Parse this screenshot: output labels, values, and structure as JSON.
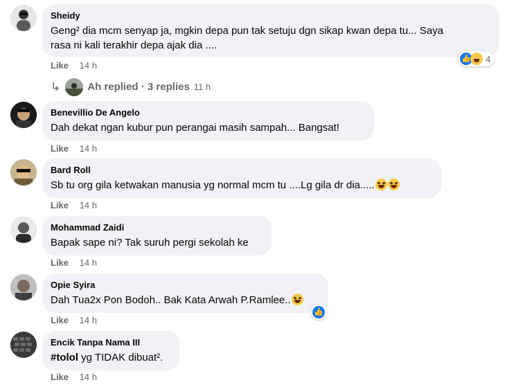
{
  "comments": [
    {
      "name": "Sheidy",
      "text_line1": "Geng² dia mcm senyap ja, mgkin depa pun tak setuju dgn sikap kwan depa tu... Saya",
      "text_line2": "rasa ni kali terakhir depa ajak dia ....",
      "like": "Like",
      "time": "14 h",
      "reaction_count": "4"
    },
    {
      "name": "Benevillio De Angelo",
      "text": "Dah dekat ngan kubur pun perangai masih sampah... Bangsat!",
      "like": "Like",
      "time": "14 h"
    },
    {
      "name": "Bard Roll",
      "text": "Sb tu org gila ketwakan manusia yg normal mcm tu ....Lg gila dr dia.....",
      "like": "Like",
      "time": "14 h"
    },
    {
      "name": "Mohammad Zaidi",
      "text": "Bapak sape ni? Tak suruh pergi sekolah ke",
      "like": "Like",
      "time": "14 h"
    },
    {
      "name": "Opie Syira",
      "text": "Dah Tua2x Pon Bodoh.. Bak Kata Arwah P.Ramlee..",
      "like": "Like",
      "time": "14 h"
    },
    {
      "name": "Encik Tanpa Nama III",
      "text_bold": "#tolol",
      "text_rest": " yg TIDAK dibuat².",
      "like": "Like",
      "time": "14 h"
    }
  ],
  "replies": {
    "label": "Ah replied · 3 replies",
    "time": "11 h"
  },
  "colors": {
    "bubble": "#f0f2f5",
    "meta": "#65676b",
    "like_reaction": "#1877f2"
  },
  "icons": [
    "reply-arrow-icon",
    "like-reaction-icon",
    "haha-reaction-icon",
    "laughing-emoji-icon"
  ]
}
